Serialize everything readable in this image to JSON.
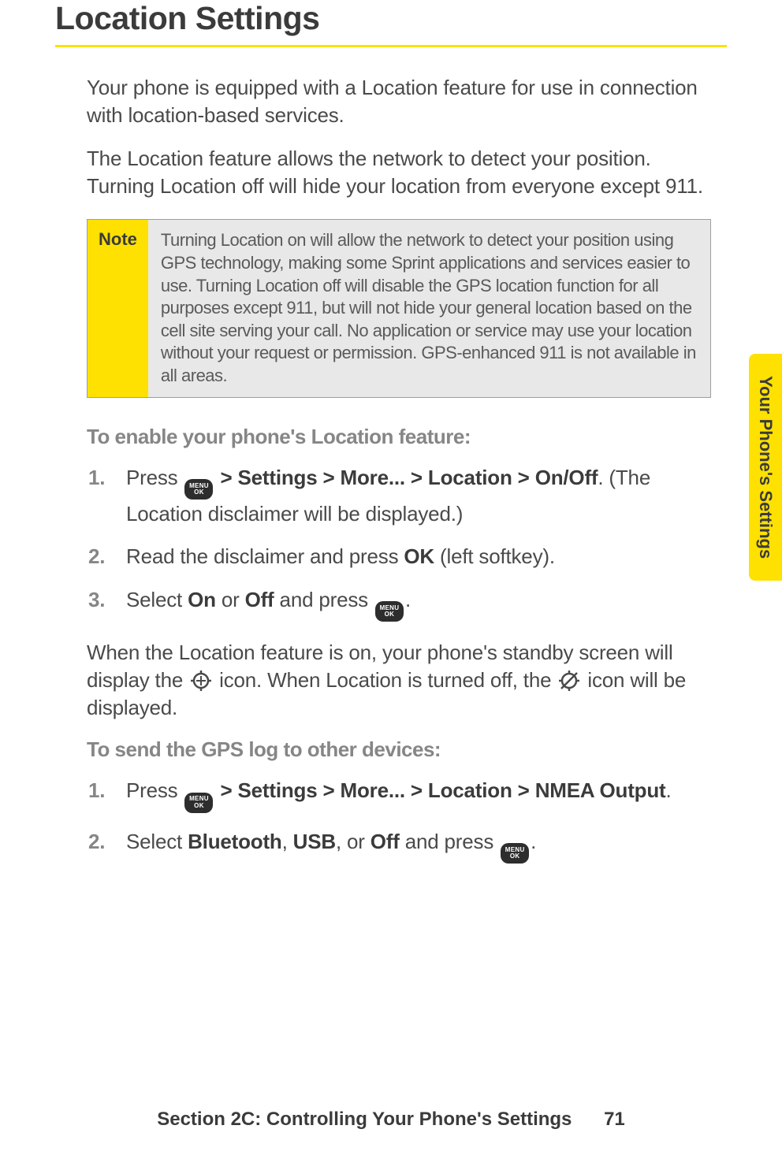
{
  "title": "Location Settings",
  "paragraphs": {
    "intro1": "Your phone is equipped with a Location feature for use in connection with location-based services.",
    "intro2": "The Location feature allows the network to detect your position. Turning Location off will hide your location from everyone except 911."
  },
  "note": {
    "label": "Note",
    "text": "Turning Location on will allow the network to detect your position using GPS technology, making some Sprint applications and services easier to use. Turning Location off will disable the GPS location function for all purposes except 911, but will not hide your general location based on the cell site serving your call. No application or service may use your location without your request or permission. GPS-enhanced 911 is not available in all areas."
  },
  "sectionA": {
    "heading": "To enable your phone's Location feature:",
    "step1_pre": "Press ",
    "step1_bold": " > Settings > More... > Location > On/Off",
    "step1_post": ". (The Location disclaimer will be displayed.)",
    "step2_pre": "Read the disclaimer and press ",
    "step2_bold": "OK",
    "step2_post": " (left softkey).",
    "step3_pre": "Select ",
    "step3_bold1": "On",
    "step3_mid": " or ",
    "step3_bold2": "Off",
    "step3_mid2": " and press ",
    "step3_post": "."
  },
  "afterA": {
    "pre": "When the Location feature is on, your phone's standby screen will display the ",
    "mid": " icon. When Location is turned off, the ",
    "post": " icon will be displayed."
  },
  "sectionB": {
    "heading": "To send the GPS log to other devices:",
    "step1_pre": "Press ",
    "step1_bold": " > Settings > More... > Location > NMEA Output",
    "step1_post": ".",
    "step2_pre": "Select ",
    "step2_b1": "Bluetooth",
    "step2_c1": ", ",
    "step2_b2": "USB",
    "step2_c2": ", or ",
    "step2_b3": "Off",
    "step2_mid": " and press ",
    "step2_post": "."
  },
  "menuok": {
    "line1": "MENU",
    "line2": "OK"
  },
  "sideTab": "Your Phone's Settings",
  "footer": {
    "section": "Section 2C: Controlling Your Phone's Settings",
    "page": "71"
  }
}
